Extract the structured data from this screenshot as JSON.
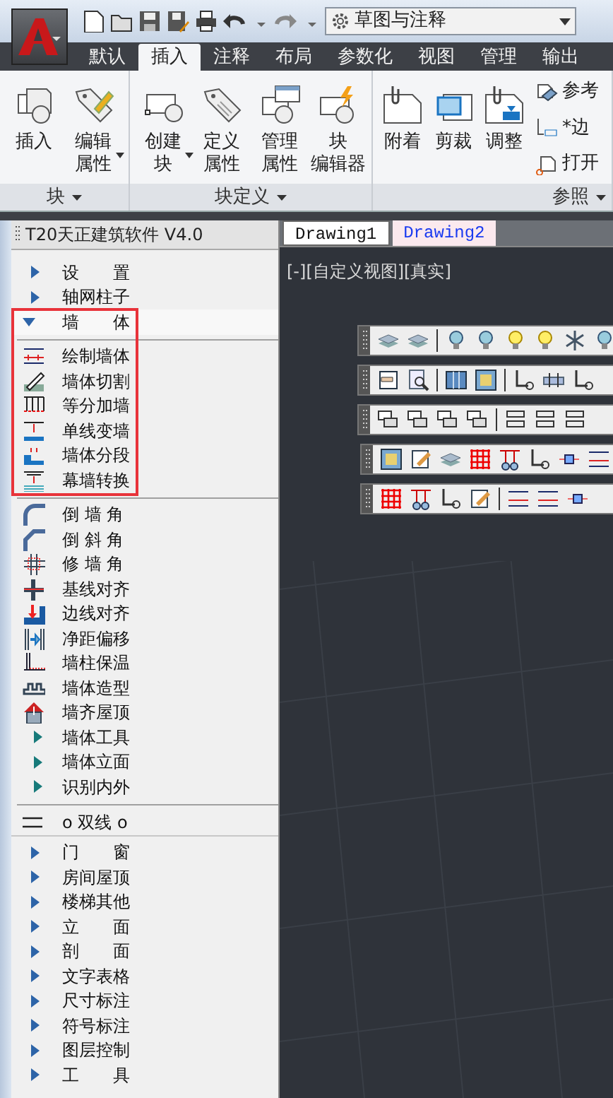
{
  "quick_access": {
    "workspace": "草图与注释"
  },
  "ribbon_tabs": [
    {
      "label": "默认",
      "selected": false
    },
    {
      "label": "插入",
      "selected": true
    },
    {
      "label": "注释",
      "selected": false
    },
    {
      "label": "布局",
      "selected": false
    },
    {
      "label": "参数化",
      "selected": false
    },
    {
      "label": "视图",
      "selected": false
    },
    {
      "label": "管理",
      "selected": false
    },
    {
      "label": "输出",
      "selected": false
    }
  ],
  "ribbon_panels": [
    {
      "title": "块",
      "buttons": [
        {
          "lines": [
            "插入"
          ],
          "dropdown": false
        },
        {
          "lines": [
            "编辑",
            "属性"
          ],
          "dropdown": true
        }
      ]
    },
    {
      "title": "块定义",
      "buttons": [
        {
          "lines": [
            "创建",
            "块"
          ],
          "dropdown": true
        },
        {
          "lines": [
            "定义",
            "属性"
          ],
          "dropdown": false
        },
        {
          "lines": [
            "管理",
            "属性"
          ],
          "dropdown": false
        },
        {
          "lines": [
            "块",
            "编辑器"
          ],
          "dropdown": false
        }
      ]
    },
    {
      "title": "参照",
      "buttons": [
        {
          "lines": [
            "附着"
          ],
          "dropdown": false
        },
        {
          "lines": [
            "剪裁"
          ],
          "dropdown": false
        },
        {
          "lines": [
            "调整"
          ],
          "dropdown": false
        }
      ],
      "small_buttons": [
        "参考",
        "*边",
        "打开"
      ]
    }
  ],
  "tool_panel": {
    "title": "T20天正建筑软件 V4.0",
    "items": [
      {
        "kind": "category",
        "label": "设　　置",
        "expanded": false
      },
      {
        "kind": "category",
        "label": "轴网柱子",
        "expanded": false
      },
      {
        "kind": "category",
        "label": "墙　　体",
        "expanded": true,
        "highlighted": true,
        "groups": [
          [
            {
              "kind": "tool",
              "label": "绘制墙体"
            },
            {
              "kind": "tool",
              "label": "墙体切割"
            },
            {
              "kind": "tool",
              "label": "等分加墙"
            },
            {
              "kind": "tool",
              "label": "单线变墙"
            },
            {
              "kind": "tool",
              "label": "墙体分段"
            },
            {
              "kind": "tool",
              "label": "幕墙转换"
            }
          ],
          [
            {
              "kind": "tool",
              "label": "倒 墙 角"
            },
            {
              "kind": "tool",
              "label": "倒 斜 角"
            },
            {
              "kind": "tool",
              "label": "修 墙 角"
            },
            {
              "kind": "tool",
              "label": "基线对齐"
            },
            {
              "kind": "tool",
              "label": "边线对齐"
            },
            {
              "kind": "tool",
              "label": "净距偏移"
            },
            {
              "kind": "tool",
              "label": "墙柱保温"
            },
            {
              "kind": "tool",
              "label": "墙体造型"
            },
            {
              "kind": "tool",
              "label": "墙齐屋顶"
            },
            {
              "kind": "submenu",
              "label": "墙体工具"
            },
            {
              "kind": "submenu",
              "label": "墙体立面"
            },
            {
              "kind": "submenu",
              "label": "识别内外"
            }
          ]
        ]
      },
      {
        "kind": "heading",
        "label": "o 双线 o"
      },
      {
        "kind": "category",
        "label": "门　　窗",
        "expanded": false
      },
      {
        "kind": "category",
        "label": "房间屋顶",
        "expanded": false
      },
      {
        "kind": "category",
        "label": "楼梯其他",
        "expanded": false
      },
      {
        "kind": "category",
        "label": "立　　面",
        "expanded": false
      },
      {
        "kind": "category",
        "label": "剖　　面",
        "expanded": false
      },
      {
        "kind": "category",
        "label": "文字表格",
        "expanded": false
      },
      {
        "kind": "category",
        "label": "尺寸标注",
        "expanded": false
      },
      {
        "kind": "category",
        "label": "符号标注",
        "expanded": false
      },
      {
        "kind": "category",
        "label": "图层控制",
        "expanded": false
      },
      {
        "kind": "category",
        "label": "工　　具",
        "expanded": false
      }
    ]
  },
  "drawing_tabs": [
    {
      "label": "Drawing1",
      "selected": false
    },
    {
      "label": "Drawing2",
      "selected": true
    }
  ],
  "viewport": {
    "label": "[-][自定义视图][真实]"
  }
}
